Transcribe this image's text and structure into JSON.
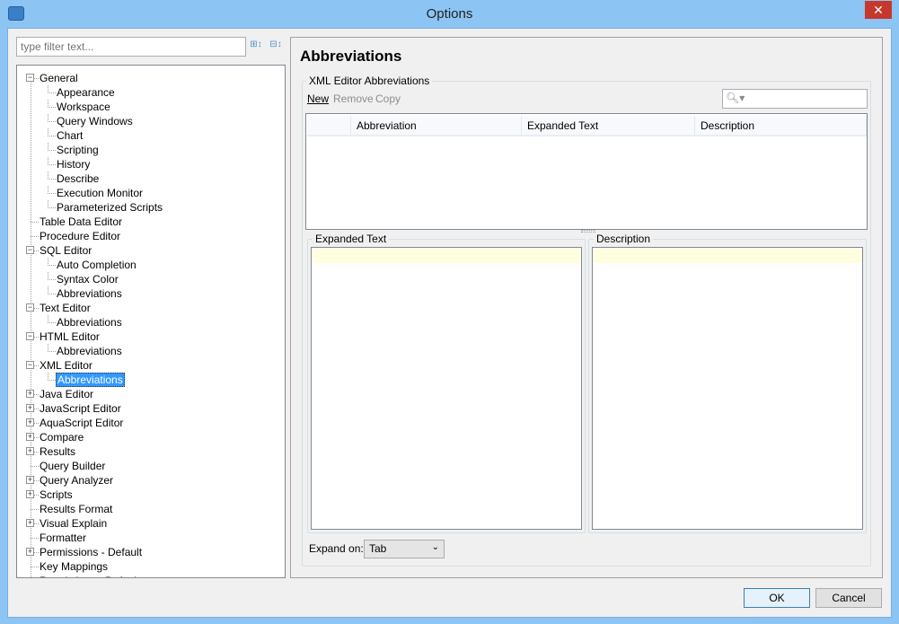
{
  "window": {
    "title": "Options",
    "close_label": "✕"
  },
  "filter": {
    "placeholder": "type filter text..."
  },
  "tree": [
    {
      "label": "General",
      "level": 0,
      "state": "expanded"
    },
    {
      "label": "Appearance",
      "level": 1
    },
    {
      "label": "Workspace",
      "level": 1
    },
    {
      "label": "Query Windows",
      "level": 1
    },
    {
      "label": "Chart",
      "level": 1
    },
    {
      "label": "Scripting",
      "level": 1
    },
    {
      "label": "History",
      "level": 1
    },
    {
      "label": "Describe",
      "level": 1
    },
    {
      "label": "Execution Monitor",
      "level": 1
    },
    {
      "label": "Parameterized Scripts",
      "level": 1
    },
    {
      "label": "Table Data Editor",
      "level": 0
    },
    {
      "label": "Procedure Editor",
      "level": 0
    },
    {
      "label": "SQL Editor",
      "level": 0,
      "state": "expanded"
    },
    {
      "label": "Auto Completion",
      "level": 1
    },
    {
      "label": "Syntax Color",
      "level": 1
    },
    {
      "label": "Abbreviations",
      "level": 1
    },
    {
      "label": "Text Editor",
      "level": 0,
      "state": "expanded"
    },
    {
      "label": "Abbreviations",
      "level": 1
    },
    {
      "label": "HTML Editor",
      "level": 0,
      "state": "expanded"
    },
    {
      "label": "Abbreviations",
      "level": 1
    },
    {
      "label": "XML Editor",
      "level": 0,
      "state": "expanded"
    },
    {
      "label": "Abbreviations",
      "level": 1,
      "selected": true
    },
    {
      "label": "Java Editor",
      "level": 0,
      "state": "collapsed"
    },
    {
      "label": "JavaScript Editor",
      "level": 0,
      "state": "collapsed"
    },
    {
      "label": "AquaScript Editor",
      "level": 0,
      "state": "collapsed"
    },
    {
      "label": "Compare",
      "level": 0,
      "state": "collapsed"
    },
    {
      "label": "Results",
      "level": 0,
      "state": "collapsed"
    },
    {
      "label": "Query Builder",
      "level": 0
    },
    {
      "label": "Query Analyzer",
      "level": 0,
      "state": "collapsed"
    },
    {
      "label": "Scripts",
      "level": 0,
      "state": "collapsed"
    },
    {
      "label": "Results Format",
      "level": 0
    },
    {
      "label": "Visual Explain",
      "level": 0,
      "state": "collapsed"
    },
    {
      "label": "Formatter",
      "level": 0
    },
    {
      "label": "Permissions - Default",
      "level": 0,
      "state": "collapsed"
    },
    {
      "label": "Key Mappings",
      "level": 0
    },
    {
      "label": "Restrictions - Default",
      "level": 0
    }
  ],
  "main": {
    "heading": "Abbreviations",
    "group_label": "XML Editor Abbreviations",
    "toolbar": {
      "new": "New",
      "remove": "Remove",
      "copy": "Copy"
    },
    "table": {
      "columns": [
        "",
        "Abbreviation",
        "Expanded Text",
        "Description"
      ],
      "rows": []
    },
    "expanded_text_label": "Expanded Text",
    "description_label": "Description",
    "expand_on_label": "Expand on:",
    "expand_on_value": "Tab"
  },
  "buttons": {
    "ok": "OK",
    "cancel": "Cancel"
  }
}
